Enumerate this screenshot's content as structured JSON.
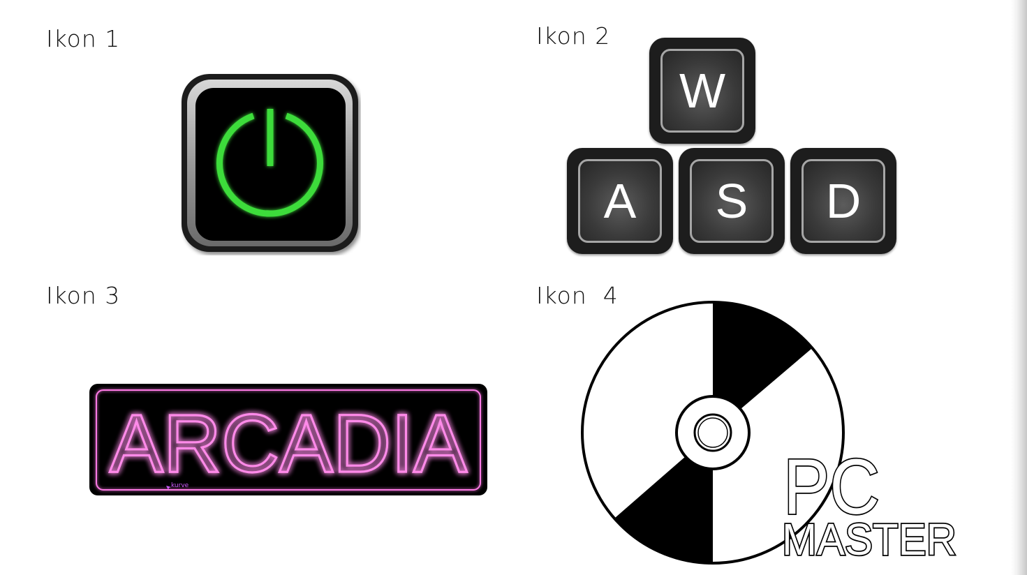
{
  "labels": {
    "icon1": "Ikon 1",
    "icon2": "Ikon 2",
    "icon3": "Ikon 3",
    "icon4": "Ikon  4"
  },
  "icon1": {
    "icon": "power-icon",
    "glow_color": "#3ddc3a"
  },
  "icon2": {
    "keys": [
      "W",
      "A",
      "S",
      "D"
    ]
  },
  "icon3": {
    "text": "ARCADIA",
    "small_label": "kurve",
    "neon_color": "#ff7ae6"
  },
  "icon4": {
    "icon": "disc-icon",
    "line1": "PC",
    "line2": "MASTER"
  }
}
